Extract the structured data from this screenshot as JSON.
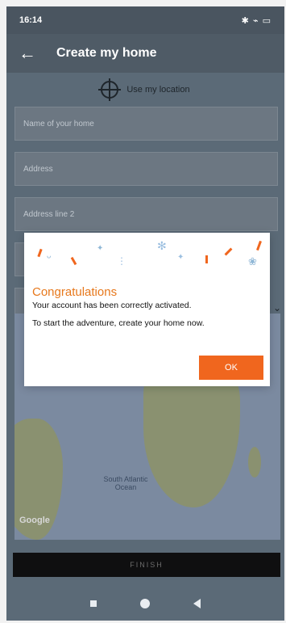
{
  "statusbar": {
    "time": "16:14",
    "right": "✱ ⌁ ▭"
  },
  "appbar": {
    "title": "Create my home"
  },
  "form": {
    "use_location": "Use my location",
    "fields": [
      {
        "placeholder": "Name of your home"
      },
      {
        "placeholder": "Address"
      },
      {
        "placeholder": "Address line 2"
      }
    ]
  },
  "map": {
    "ocean_label": "South Atlantic Ocean",
    "attribution": "Google"
  },
  "dialog": {
    "title": "Congratulations",
    "line1": "Your account has been correctly activated.",
    "line2": "To start the adventure, create your home now.",
    "ok_label": "OK"
  },
  "finish": {
    "label": "FINISH"
  },
  "colors": {
    "accent": "#f0661e",
    "title_color": "#e7781c"
  }
}
